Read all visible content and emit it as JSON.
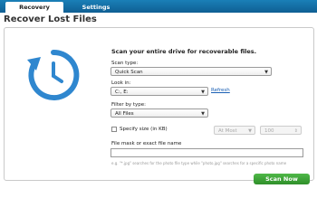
{
  "tabs": [
    {
      "label": "Recovery",
      "active": true
    },
    {
      "label": "Settings",
      "active": false
    }
  ],
  "page_title": "Recover Lost Files",
  "hero_icon": "restore-clock-icon",
  "colors": {
    "accent": "#1a7fb7",
    "icon": "#2f87cf",
    "button": "#3ea236"
  },
  "form": {
    "heading": "Scan your entire drive for recoverable files.",
    "scan_type": {
      "label": "Scan type:",
      "value": "Quick Scan"
    },
    "look_in": {
      "label": "Look in:",
      "value": "C:, E:",
      "refresh": "Refresh"
    },
    "filter": {
      "label": "Filter by type:",
      "value": "All Files"
    },
    "size": {
      "checkbox_label": "Specify size (in KB)",
      "comparator": "At Most",
      "value": "100"
    },
    "file_mask": {
      "label": "File mask or exact file name",
      "value": "",
      "hint": "e.g. \"*.jpg\" searches for the photo file type while \"photo.jpg\" searches for a specific photo name"
    }
  },
  "scan_button": "Scan Now"
}
